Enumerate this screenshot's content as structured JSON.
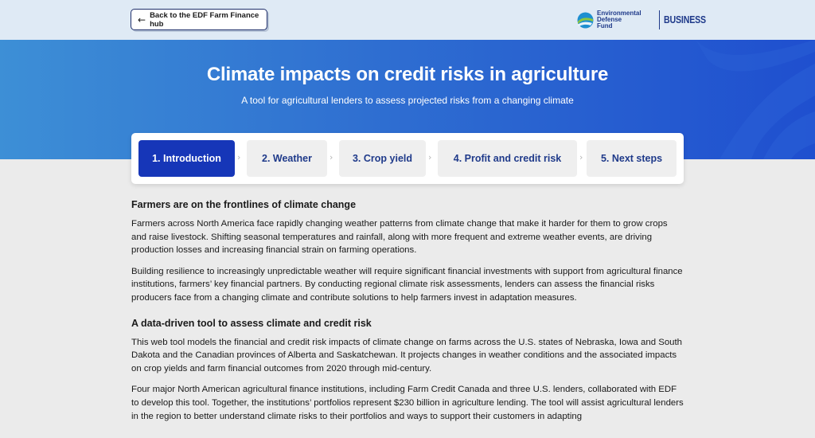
{
  "nav": {
    "back_label": "Back to the EDF Farm Finance hub",
    "org_name_line1": "Environmental",
    "org_name_line2": "Defense",
    "org_name_line3": "Fund",
    "business_label": "BUSINESS"
  },
  "hero": {
    "title": "Climate impacts on credit risks in agriculture",
    "subtitle": "A tool for agricultural lenders to assess projected risks from a changing climate"
  },
  "steps": [
    {
      "label": "1.  Introduction"
    },
    {
      "label": "2.  Weather"
    },
    {
      "label": "3.  Crop yield"
    },
    {
      "label": "4.  Profit and credit risk"
    },
    {
      "label": "5.  Next steps"
    }
  ],
  "content": {
    "section1": {
      "heading": "Farmers are on the frontlines of climate change",
      "p1": "Farmers across North America face rapidly changing weather patterns from climate change that make it harder for them to grow crops and raise livestock. Shifting seasonal temperatures and rainfall, along with more frequent and extreme weather events, are driving production losses and increasing financial strain on farming operations.",
      "p2": "Building resilience to increasingly unpredictable weather will require significant financial investments with support from agricultural finance institutions, farmers’ key financial partners. By conducting regional climate risk assessments, lenders can assess the financial risks producers face from a changing climate and contribute solutions to help farmers invest in adaptation measures."
    },
    "section2": {
      "heading": "A data-driven tool to assess climate and credit risk",
      "p1": "This web tool models the financial and credit risk impacts of climate change on farms across the U.S. states of Nebraska, Iowa and South Dakota and the Canadian provinces of Alberta and Saskatchewan. It projects changes in weather conditions and the associated impacts on crop yields and farm financial outcomes from 2020 through mid-century.",
      "p2": "Four major North American agricultural finance institutions, including Farm Credit Canada and three U.S. lenders, collaborated with EDF to develop this tool. Together, the institutions’ portfolios represent $230 billion in agriculture lending. The tool will assist agricultural lenders in the region to better understand climate risks to their portfolios and ways to support their customers in adapting"
    }
  },
  "colors": {
    "accent": "#1636b8",
    "hero_start": "#3d8fd6",
    "hero_end": "#1f4fcf",
    "brand": "#1f3a8a"
  }
}
